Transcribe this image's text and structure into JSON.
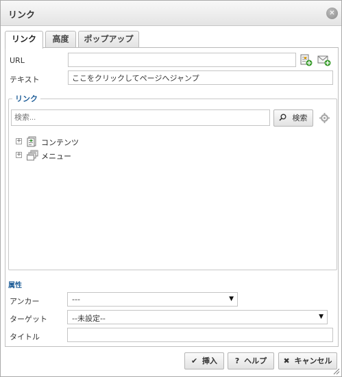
{
  "dialog": {
    "title": "リンク",
    "close_icon": "close-icon"
  },
  "tabs": [
    {
      "label": "リンク",
      "active": true
    },
    {
      "label": "高度",
      "active": false
    },
    {
      "label": "ポップアップ",
      "active": false
    }
  ],
  "form": {
    "url_label": "URL",
    "url_value": "",
    "text_label": "テキスト",
    "text_value": "ここをクリックしてページへジャンプ"
  },
  "link_section": {
    "legend": "リンク",
    "search_placeholder": "検索...",
    "search_button": "検索",
    "tree": [
      {
        "label": "コンテンツ",
        "icon": "document-icon"
      },
      {
        "label": "メニュー",
        "icon": "window-stack-icon"
      }
    ]
  },
  "attributes": {
    "title": "属性",
    "anchor_label": "アンカー",
    "anchor_value": "---",
    "target_label": "ターゲット",
    "target_value": "--未設定--",
    "title_label": "タイトル",
    "title_value": ""
  },
  "footer": {
    "insert": "挿入",
    "help": "ヘルプ",
    "cancel": "キャンセル"
  },
  "colors": {
    "legend_blue": "#1f5e98"
  }
}
